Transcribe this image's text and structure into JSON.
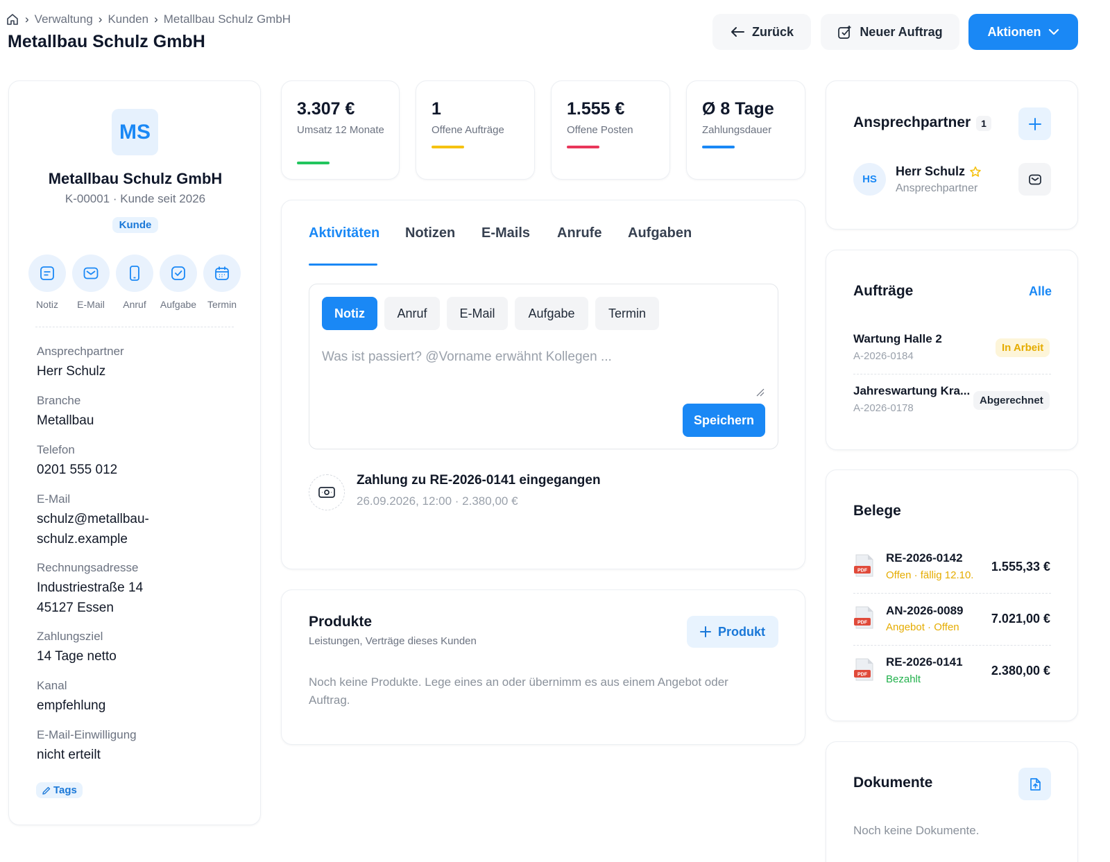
{
  "breadcrumb": {
    "items": [
      "Verwaltung",
      "Kunden",
      "Metallbau Schulz GmbH"
    ]
  },
  "page": {
    "title": "Metallbau Schulz GmbH"
  },
  "header_actions": {
    "back": "Zurück",
    "new_order": "Neuer Auftrag",
    "actions": "Aktionen"
  },
  "customer": {
    "initials": "MS",
    "name": "Metallbau Schulz GmbH",
    "subtitle": "K-00001 · Kunde seit 2026",
    "type_badge": "Kunde",
    "quick_actions": [
      "Notiz",
      "E-Mail",
      "Anruf",
      "Aufgabe",
      "Termin"
    ],
    "fields": [
      {
        "label": "Ansprechpartner",
        "value": "Herr Schulz"
      },
      {
        "label": "Branche",
        "value": "Metallbau"
      },
      {
        "label": "Telefon",
        "value": "0201 555 012"
      },
      {
        "label": "E-Mail",
        "value": "schulz@metallbau-schulz.example"
      },
      {
        "label": "Rechnungsadresse",
        "value": "Industriestraße 14",
        "value2": "45127 Essen"
      },
      {
        "label": "Zahlungsziel",
        "value": "14 Tage netto"
      },
      {
        "label": "Kanal",
        "value": "empfehlung"
      },
      {
        "label": "E-Mail-Einwilligung",
        "value": "nicht erteilt"
      }
    ],
    "tags_label": "Tags"
  },
  "stats": [
    {
      "value": "3.307 €",
      "label": "Umsatz 12 Monate",
      "color": "#22c55e"
    },
    {
      "value": "1",
      "label": "Offene Aufträge",
      "color": "#f5c211"
    },
    {
      "value": "1.555 €",
      "label": "Offene Posten",
      "color": "#e9365a"
    },
    {
      "value": "Ø 8 Tage",
      "label": "Zahlungsdauer",
      "color": "#1a88f5"
    }
  ],
  "activity": {
    "tabs": [
      "Aktivitäten",
      "Notizen",
      "E-Mails",
      "Anrufe",
      "Aufgaben"
    ],
    "types": [
      "Notiz",
      "Anruf",
      "E-Mail",
      "Aufgabe",
      "Termin"
    ],
    "placeholder": "Was ist passiert? @Vorname erwähnt Kollegen ...",
    "save": "Speichern",
    "feed": [
      {
        "title": "Zahlung zu RE-2026-0141 eingegangen",
        "meta": "26.09.2026, 12:00 · 2.380,00 €"
      }
    ]
  },
  "products": {
    "title": "Produkte",
    "subtitle": "Leistungen, Verträge dieses Kunden",
    "add": "Produkt",
    "empty": "Noch keine Produkte. Lege eines an oder übernimm es aus einem Angebot oder Auftrag."
  },
  "contacts": {
    "title": "Ansprechpartner",
    "count": "1",
    "items": [
      {
        "initials": "HS",
        "name": "Herr Schulz",
        "role": "Ansprechpartner"
      }
    ]
  },
  "orders": {
    "title": "Aufträge",
    "all": "Alle",
    "items": [
      {
        "name": "Wartung Halle 2",
        "number": "A-2026-0184",
        "status": "In Arbeit"
      },
      {
        "name": "Jahreswartung Kra...",
        "number": "A-2026-0178",
        "status": "Abgerechnet"
      }
    ]
  },
  "documents_list": {
    "title": "Belege",
    "items": [
      {
        "number": "RE-2026-0142",
        "status": "Offen · fällig 12.10.",
        "amount": "1.555,33 €",
        "status_color": "#e5ac00"
      },
      {
        "number": "AN-2026-0089",
        "status": "Angebot · Offen",
        "amount": "7.021,00 €",
        "status_color": "#e5ac00"
      },
      {
        "number": "RE-2026-0141",
        "status": "Bezahlt",
        "amount": "2.380,00 €",
        "status_color": "#22b14c"
      }
    ],
    "pdf_label": "PDF"
  },
  "files": {
    "title": "Dokumente",
    "empty": "Noch keine Dokumente."
  },
  "colors": {
    "accent": "#1a88f5",
    "text": "#0f172a",
    "muted": "#6b7280"
  }
}
